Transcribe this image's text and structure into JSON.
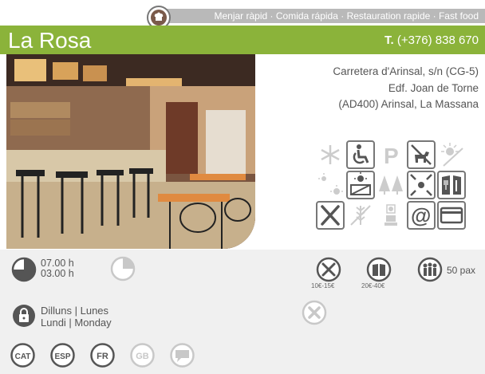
{
  "category": {
    "icon": "chef-hat-icon",
    "label": "Menjar ràpid · Comida rápida · Restauration rapide · Fast food"
  },
  "restaurant": {
    "name": "La Rosa",
    "phone_prefix": "T.",
    "phone": "(+376) 838 670"
  },
  "address": {
    "line1": "Carretera d'Arinsal, s/n (CG-5)",
    "line2": "Edf. Joan de Torne",
    "line3": "(AD400) Arinsal, La Massana"
  },
  "services": [
    [
      {
        "icon": "snowflake-icon",
        "active": false
      },
      {
        "icon": "wheelchair-icon",
        "active": true
      },
      {
        "icon": "parking-icon",
        "active": false
      },
      {
        "icon": "dog-icon",
        "active": true
      },
      {
        "icon": "no-sun-icon",
        "active": false
      }
    ],
    [
      {
        "icon": "sun-shade-icon",
        "active": false
      },
      {
        "icon": "terrace-icon",
        "active": true
      },
      {
        "icon": "trees-icon",
        "active": false
      },
      {
        "icon": "viewpoint-icon",
        "active": true
      },
      {
        "icon": "menu-book-icon",
        "active": true
      }
    ],
    [
      {
        "icon": "cutlery-cross-icon",
        "active": true
      },
      {
        "icon": "gluten-free-icon",
        "active": false
      },
      {
        "icon": "baby-chair-icon",
        "active": false
      },
      {
        "icon": "at-sign-icon",
        "active": true
      },
      {
        "icon": "credit-card-icon",
        "active": true
      }
    ]
  ],
  "schedule": {
    "open": "07.00 h",
    "close": "03.00 h"
  },
  "closed_days": {
    "line1": "Dilluns | Lunes",
    "line2": "Lundi | Monday"
  },
  "prices": {
    "menu_price": "10€-15€",
    "carte_price": "20€-40€"
  },
  "capacity": "50 pax",
  "languages": [
    {
      "code": "CAT",
      "active": true
    },
    {
      "code": "ESP",
      "active": true
    },
    {
      "code": "FR",
      "active": true
    },
    {
      "code": "GB",
      "active": false
    }
  ],
  "colors": {
    "brand_green": "#8bb33a",
    "bar_grey": "#b9b9b9",
    "icon_dark": "#555555",
    "icon_light": "#c8c8c8"
  }
}
